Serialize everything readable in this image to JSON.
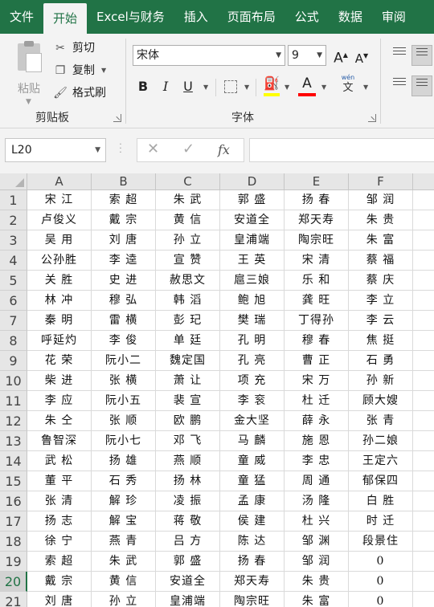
{
  "ribbon": {
    "tabs": [
      "文件",
      "开始",
      "Excel与财务",
      "插入",
      "页面布局",
      "公式",
      "数据",
      "审阅"
    ],
    "active_tab": "开始",
    "clipboard": {
      "paste_label": "粘贴",
      "cut_label": "剪切",
      "copy_label": "复制",
      "format_painter_label": "格式刷",
      "group_label": "剪贴板"
    },
    "font": {
      "font_name": "宋体",
      "font_size": "9",
      "group_label": "字体",
      "increase_label": "A",
      "decrease_label": "A",
      "bold": "B",
      "italic": "I",
      "underline": "U",
      "font_color_letter": "A",
      "phonetic_top": "wén",
      "phonetic_bottom": "文",
      "fill_color": "#ffff00",
      "font_color": "#ff0000"
    }
  },
  "formula_bar": {
    "name_box": "L20",
    "cancel": "✕",
    "enter": "✓",
    "fx": "fx",
    "formula": ""
  },
  "sheet": {
    "columns": [
      "A",
      "B",
      "C",
      "D",
      "E",
      "F"
    ],
    "selected_row": "20",
    "rows": [
      {
        "n": "1",
        "cells": [
          "宋 江",
          "索 超",
          "朱 武",
          "郭 盛",
          "扬 春",
          "邹 润"
        ]
      },
      {
        "n": "2",
        "cells": [
          "卢俊义",
          "戴 宗",
          "黄 信",
          "安道全",
          "郑天寿",
          "朱 贵"
        ]
      },
      {
        "n": "3",
        "cells": [
          "吴 用",
          "刘 唐",
          "孙 立",
          "皇浦端",
          "陶宗旺",
          "朱 富"
        ]
      },
      {
        "n": "4",
        "cells": [
          "公孙胜",
          "李 逵",
          "宣 赞",
          "王 英",
          "宋 清",
          "蔡 福"
        ]
      },
      {
        "n": "5",
        "cells": [
          "关 胜",
          "史 进",
          "赦思文",
          "扈三娘",
          "乐 和",
          "蔡 庆"
        ]
      },
      {
        "n": "6",
        "cells": [
          "林 冲",
          "穆 弘",
          "韩 滔",
          "鲍 旭",
          "龚 旺",
          "李 立"
        ]
      },
      {
        "n": "7",
        "cells": [
          "秦 明",
          "雷 横",
          "彭 玘",
          "樊 瑞",
          "丁得孙",
          "李 云"
        ]
      },
      {
        "n": "8",
        "cells": [
          "呼延灼",
          "李 俊",
          "单 廷",
          "孔 明",
          "穆 春",
          "焦 挺"
        ]
      },
      {
        "n": "9",
        "cells": [
          "花 荣",
          "阮小二",
          "魏定国",
          "孔 亮",
          "曹 正",
          "石 勇"
        ]
      },
      {
        "n": "10",
        "cells": [
          "柴 进",
          "张 横",
          "萧 让",
          "项 充",
          "宋 万",
          "孙 新"
        ]
      },
      {
        "n": "11",
        "cells": [
          "李 应",
          "阮小五",
          "裴 宣",
          "李 衮",
          "杜 迁",
          "顾大嫂"
        ]
      },
      {
        "n": "12",
        "cells": [
          "朱 仝",
          "张 顺",
          "欧 鹏",
          "金大坚",
          "薛 永",
          "张 青"
        ]
      },
      {
        "n": "13",
        "cells": [
          "鲁智深",
          "阮小七",
          "邓 飞",
          "马 麟",
          "施 恩",
          "孙二娘"
        ]
      },
      {
        "n": "14",
        "cells": [
          "武 松",
          "扬 雄",
          "燕 顺",
          "童 威",
          "李 忠",
          "王定六"
        ]
      },
      {
        "n": "15",
        "cells": [
          "董 平",
          "石 秀",
          "扬 林",
          "童 猛",
          "周 通",
          "郁保四"
        ]
      },
      {
        "n": "16",
        "cells": [
          "张 清",
          "解 珍",
          "凌 振",
          "孟 康",
          "汤 隆",
          "白 胜"
        ]
      },
      {
        "n": "17",
        "cells": [
          "扬 志",
          "解 宝",
          "蒋 敬",
          "侯 建",
          "杜 兴",
          "时 迁"
        ]
      },
      {
        "n": "18",
        "cells": [
          "徐 宁",
          "燕 青",
          "吕 方",
          "陈 达",
          "邹 渊",
          "段景住"
        ]
      },
      {
        "n": "19",
        "cells": [
          "索 超",
          "朱 武",
          "郭 盛",
          "扬 春",
          "邹 润",
          "0"
        ]
      },
      {
        "n": "20",
        "cells": [
          "戴 宗",
          "黄 信",
          "安道全",
          "郑天寿",
          "朱 贵",
          "0"
        ]
      },
      {
        "n": "21",
        "cells": [
          "刘 唐",
          "孙 立",
          "皇浦端",
          "陶宗旺",
          "朱 富",
          "0"
        ]
      }
    ]
  }
}
